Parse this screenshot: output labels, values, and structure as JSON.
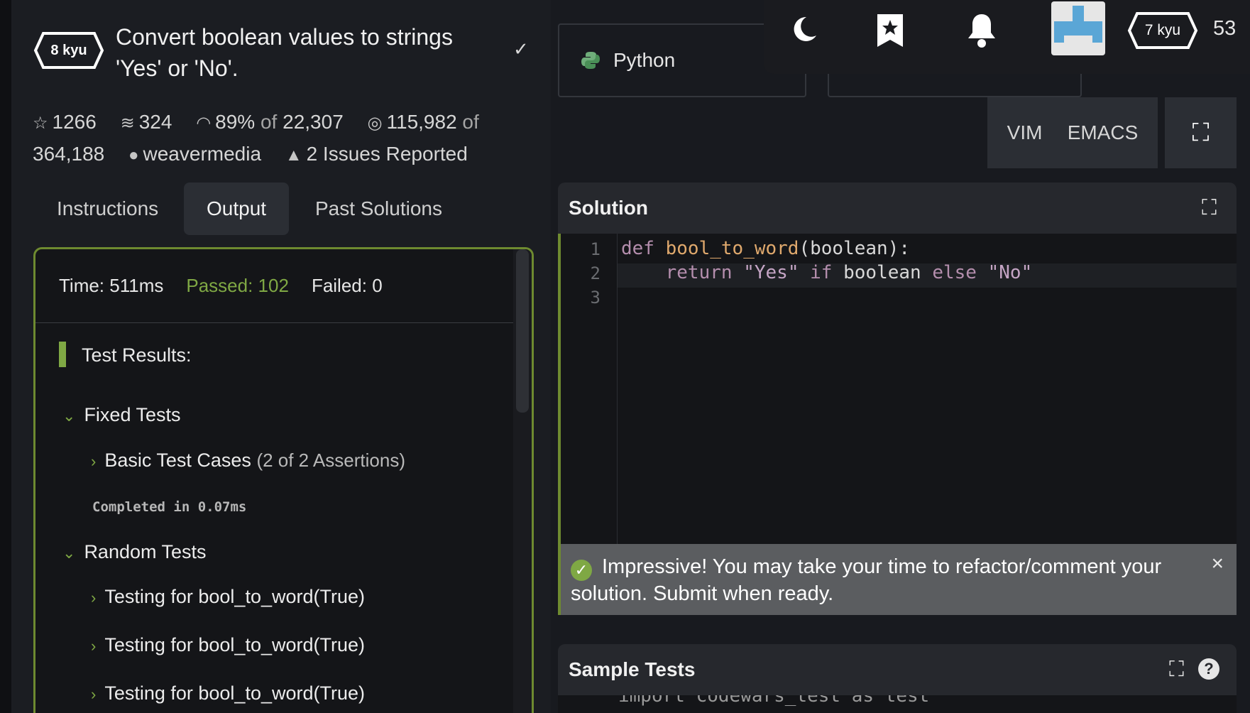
{
  "kata": {
    "rank": "8 kyu",
    "title_line1": "Convert boolean values to strings",
    "title_line2": "'Yes' or 'No'.",
    "stars": "1266",
    "collections": "324",
    "satisfaction": "89%",
    "of_label": "of",
    "votes": "22,307",
    "completed": "115,982",
    "completed_of": "of",
    "total": "364,188",
    "author": "weavermedia",
    "issues": "2 Issues Reported"
  },
  "tabs": [
    "Instructions",
    "Output",
    "Past Solutions"
  ],
  "output": {
    "time": "Time: 511ms",
    "passed": "Passed: 102",
    "failed": "Failed: 0",
    "results_title": "Test Results:",
    "groups": [
      {
        "label": "Fixed Tests"
      },
      {
        "label": "Random Tests"
      }
    ],
    "basic_cases": "Basic Test Cases",
    "basic_assert": "(2 of 2 Assertions)",
    "completed_in": "Completed in 0.07ms",
    "random_items": [
      "Testing for bool_to_word(True)",
      "Testing for bool_to_word(True)",
      "Testing for bool_to_word(True)"
    ]
  },
  "editor": {
    "language": "Python",
    "modes": [
      "VIM",
      "EMACS"
    ],
    "solution_title": "Solution",
    "line_numbers": [
      "1",
      "2",
      "3"
    ],
    "code": {
      "l1_def": "def",
      "l1_fn": "bool_to_word",
      "l1_rest": "(boolean):",
      "l2_return": "return",
      "l2_yes": "\"Yes\"",
      "l2_if": "if",
      "l2_var": "boolean",
      "l2_else": "else",
      "l2_no": "\"No\""
    },
    "toast": "Impressive! You may take your time to refactor/comment your solution. Submit when ready.",
    "sample_title": "Sample Tests",
    "sample_line": "import codewars_test as test"
  },
  "topbar": {
    "user_rank": "7 kyu",
    "honor": "53"
  },
  "icons": {
    "theme": "moon-icon",
    "bookmark": "bookmark-star-icon",
    "notifications": "bell-icon",
    "fullscreen": "expand-icon"
  },
  "colors": {
    "accent": "#7fa844",
    "background": "#181a1f"
  }
}
